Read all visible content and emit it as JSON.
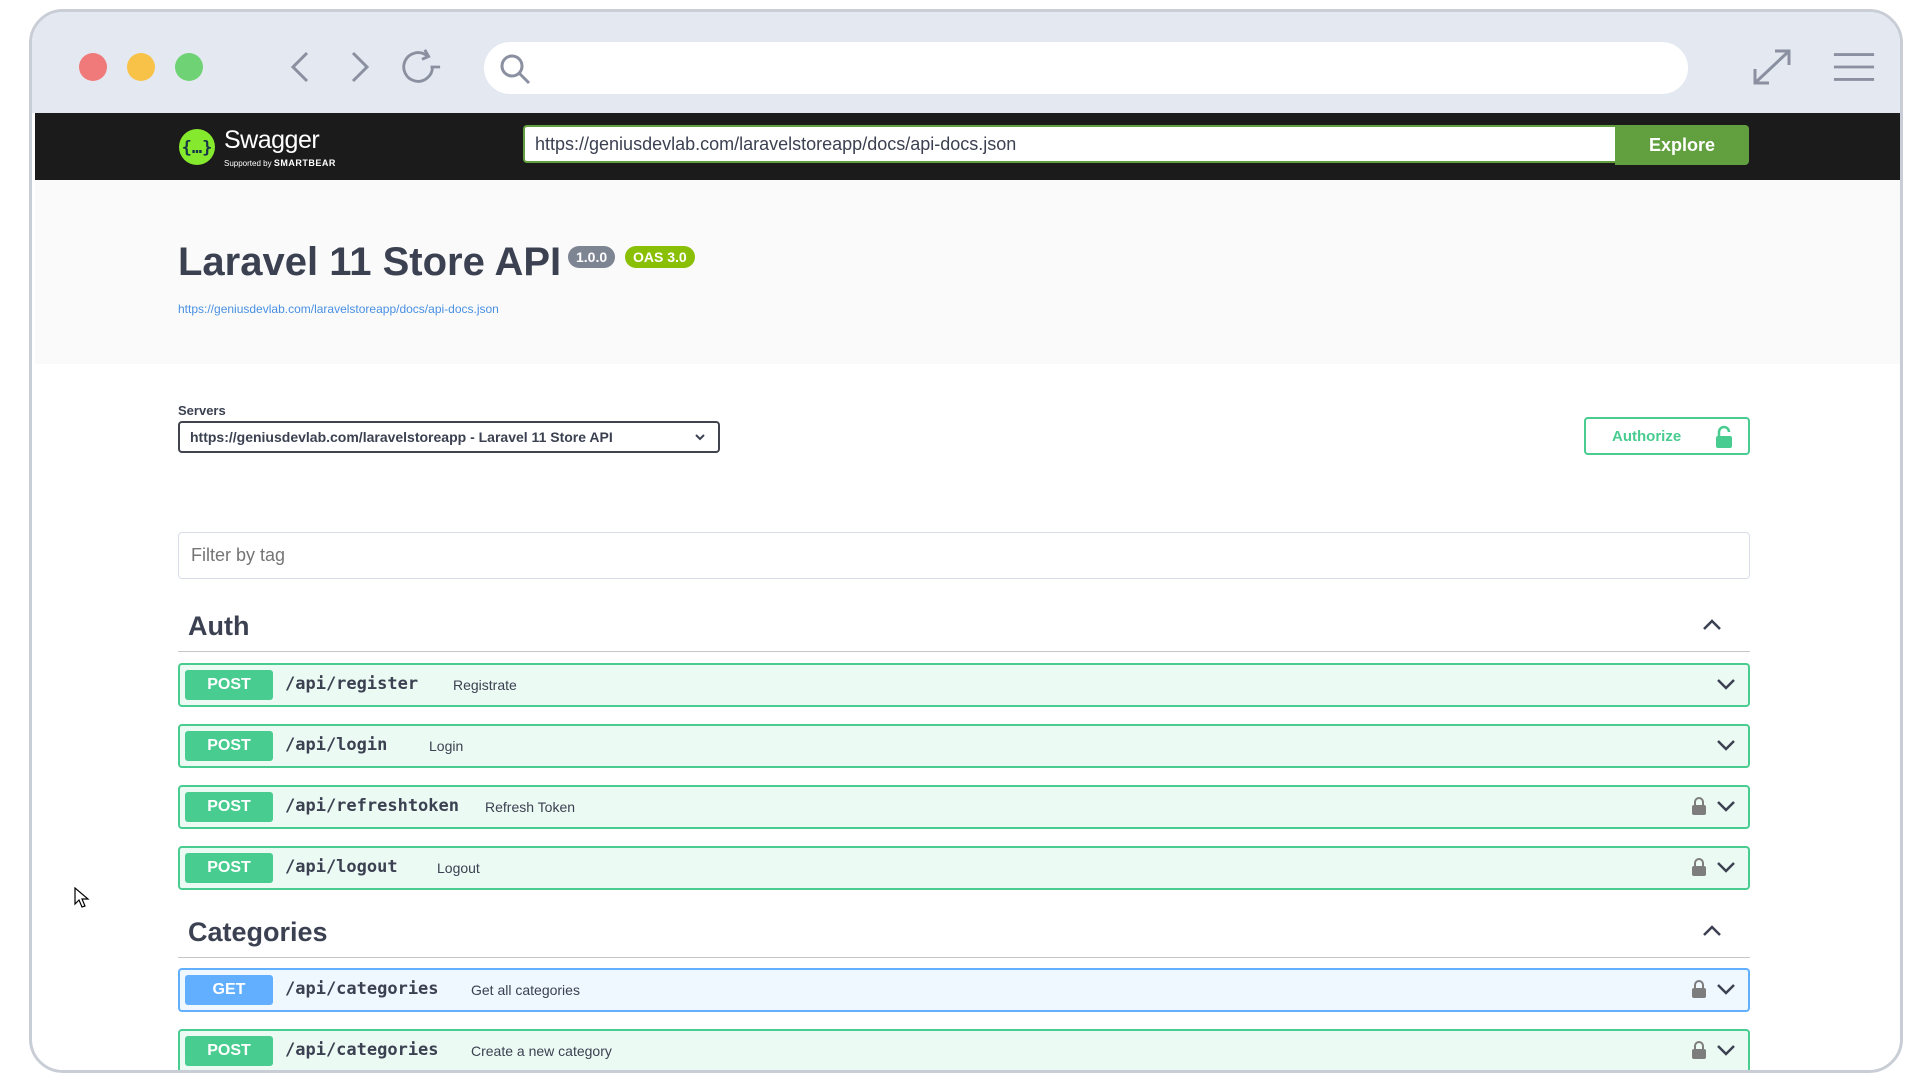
{
  "browser": {
    "url_value": ""
  },
  "topbar": {
    "logo_text": "Swagger",
    "logo_supported": "Supported by",
    "logo_smartbear": "SMARTBEAR",
    "spec_url": "https://geniusdevlab.com/laravelstoreapp/docs/api-docs.json",
    "explore_label": "Explore"
  },
  "info": {
    "title": "Laravel 11 Store API",
    "version": "1.0.0",
    "oas": "OAS 3.0",
    "link": "https://geniusdevlab.com/laravelstoreapp/docs/api-docs.json"
  },
  "schemes": {
    "servers_label": "Servers",
    "selected_server": "https://geniusdevlab.com/laravelstoreapp - Laravel 11 Store API",
    "authorize_label": "Authorize"
  },
  "filter": {
    "placeholder": "Filter by tag"
  },
  "tags": [
    {
      "name": "Auth",
      "operations": [
        {
          "method": "POST",
          "path": "/api/register",
          "summary": "Registrate",
          "locked": false
        },
        {
          "method": "POST",
          "path": "/api/login",
          "summary": "Login",
          "locked": false
        },
        {
          "method": "POST",
          "path": "/api/refreshtoken",
          "summary": "Refresh Token",
          "locked": true
        },
        {
          "method": "POST",
          "path": "/api/logout",
          "summary": "Logout",
          "locked": true
        }
      ]
    },
    {
      "name": "Categories",
      "operations": [
        {
          "method": "GET",
          "path": "/api/categories",
          "summary": "Get all categories",
          "locked": true
        },
        {
          "method": "POST",
          "path": "/api/categories",
          "summary": "Create a new category",
          "locked": true
        }
      ]
    }
  ],
  "colors": {
    "post": "#49cc90",
    "get": "#61affe",
    "explore": "#62a03f",
    "topbar": "#1b1b1b"
  }
}
